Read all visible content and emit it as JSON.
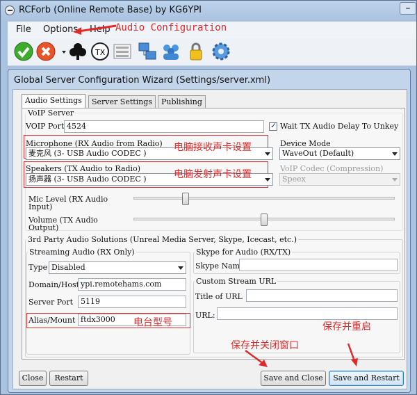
{
  "window": {
    "title": "RCForb (Online Remote Base) by KG6YPI",
    "minimize": "–"
  },
  "menu": [
    {
      "label": "File"
    },
    {
      "label": "Options"
    },
    {
      "label": "Help"
    }
  ],
  "annotations": {
    "menu_note": "Audio Configuration",
    "mic_note": "电脑接收声卡设置",
    "spk_note": "电脑发射声卡设置",
    "alias_note": "电台型号",
    "save_close_note": "保存并关闭窗口",
    "save_restart_note": "保存并重启"
  },
  "toolbar": [
    "check-icon",
    "stop-icon",
    "club-icon",
    "tx-icon",
    "list-icon",
    "network-icon",
    "users-icon",
    "lock-icon",
    "gear-icon"
  ],
  "dialog": {
    "title": "Global Server Configuration Wizard (Settings/server.xml)",
    "tabs": [
      "Audio Settings",
      "Server Settings",
      "Publishing"
    ],
    "voip": {
      "group": "VoIP Server",
      "port_label": "VOIP Port",
      "port_value": "4524",
      "wait_label": "Wait TX Audio Delay To Unkey",
      "wait_checked": true
    },
    "mic": {
      "label": "Microphone (RX Audio from Radio)",
      "value": "麦克风 (3- USB Audio CODEC )"
    },
    "device_mode": {
      "label": "Device Mode",
      "value": "WaveOut (Default)"
    },
    "speakers": {
      "label": "Speakers (TX Audio to Radio)",
      "value": "扬声器 (3- USB Audio CODEC )"
    },
    "codec": {
      "label": "VoIP Codec (Compression)",
      "value": "Speex"
    },
    "mic_level": {
      "label_1": "Mic Level (RX Audio",
      "label_2": "Input)",
      "level": 0.2
    },
    "volume": {
      "label_1": "Volume (TX Audio",
      "label_2": "Output)",
      "level": 0.5
    },
    "third_party": {
      "group": "3rd Party Audio Solutions (Unreal Media Server, Skype, Icecast, etc.)",
      "streaming": {
        "group": "Streaming Audio (RX Only)",
        "type_label": "Type",
        "type_value": "Disabled",
        "host_label": "Domain/Host",
        "host_value": "ypi.remotehams.com",
        "port_label": "Server Port",
        "port_value": "5119",
        "alias_label": "Alias/Mount",
        "alias_value": "ftdx3000"
      },
      "skype": {
        "group": "Skype for Audio (RX/TX)",
        "name_label": "Skype Name",
        "name_value": ""
      },
      "custom": {
        "group": "Custom Stream URL",
        "title_label": "Title of URL",
        "title_value": "",
        "url_label": "URL:",
        "url_value": ""
      }
    },
    "buttons": {
      "close": "Close",
      "restart": "Restart",
      "save_close": "Save and Close",
      "save_restart": "Save and Restart"
    }
  }
}
